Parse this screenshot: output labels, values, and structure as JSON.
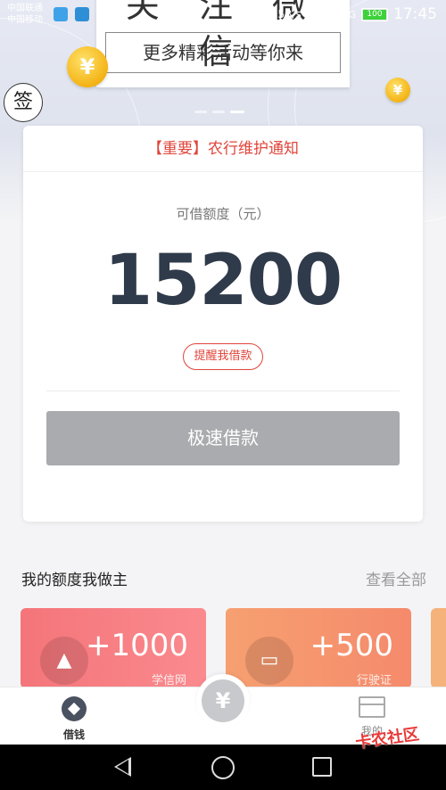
{
  "status_bar": {
    "carrier_1": "中国联通",
    "carrier_2": "中国移动",
    "net_speed": "235B/s",
    "signal_1": "4G",
    "signal_2": "2G",
    "battery": "100",
    "time": "17:45"
  },
  "banner": {
    "poster_title": "关 注 微 信",
    "poster_subtitle": "更多精彩活动等你来",
    "coin_symbol": "¥",
    "sign_button": "签",
    "page_indicator_count": 3,
    "page_indicator_active": 3
  },
  "card": {
    "notice": "【重要】农行维护通知",
    "quota_label": "可借额度（元）",
    "quota_value": "15200",
    "remind_button": "提醒我借款",
    "borrow_button": "极速借款"
  },
  "section": {
    "title": "我的额度我做主",
    "view_all": "查看全部"
  },
  "promos": [
    {
      "amount": "+1000",
      "sub": "学信网",
      "icon": "graduation-cap-icon",
      "color": "#f4757a"
    },
    {
      "amount": "+500",
      "sub": "行驶证",
      "icon": "car-icon",
      "color": "#f6a071"
    }
  ],
  "tabbar": {
    "tab_1": "借钱",
    "center_symbol": "¥",
    "tab_2": "我的"
  },
  "watermark": "卡农社区",
  "colors": {
    "accent_red": "#e0453b",
    "button_gray": "#a9abae",
    "quota_text": "#2f3a4a"
  }
}
